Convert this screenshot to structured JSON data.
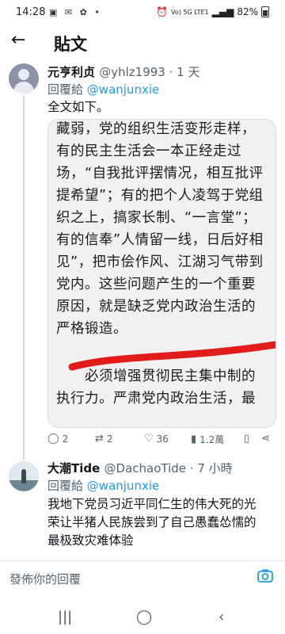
{
  "status_bar": {
    "time": "14:28",
    "left_icons": "▣ ✉ ✿ •",
    "network": "Vo) 5G LTE1",
    "battery": "82%"
  },
  "header": {
    "back_icon": "arrow-left-icon",
    "title": "貼文"
  },
  "tweet1": {
    "name": "元亨利贞",
    "handle": "@yhlz1993 · 1 天",
    "reply_prefix": "回覆給",
    "reply_to": "@wanjunxie",
    "text": "全文如下。",
    "image_lines": [
      "藏弱，党的组织生活变形走样，",
      "有的民主生活会一本正经走过",
      "场，“自我批评摆情况，相互批评",
      "提希望”；有的把个人凌驾于党组",
      "织之上，搞家长制、“一言堂”；",
      "有的信奉”人情留一线，日后好相",
      "见”，把市侩作风、江湖习气带到",
      "党内。这些问题产生的一个重要",
      "原因，就是缺乏党内政治生活的",
      "严格锻造。",
      "",
      "必须增强贯彻民主集中制的",
      "执行力。严肃党内政治生活，最"
    ],
    "actions": {
      "replies": "2",
      "retweets": "2",
      "likes": "36",
      "views": "1.2萬"
    }
  },
  "tweet2": {
    "name": "大潮Tide",
    "handle": "@DachaoTide · 7 小時",
    "reply_prefix": "回覆給",
    "reply_to": "@wanjunxie",
    "text_lines": [
      "我地下党员习近平同仁生的伟大死的光",
      "荣让半猪人民族尝到了自己愚蠢怂懦的",
      "最极致灾难体验"
    ]
  },
  "compose": {
    "placeholder": "發佈你的回覆"
  },
  "colors": {
    "accent": "#1d9bf0",
    "red_mark": "#e21b1b"
  }
}
